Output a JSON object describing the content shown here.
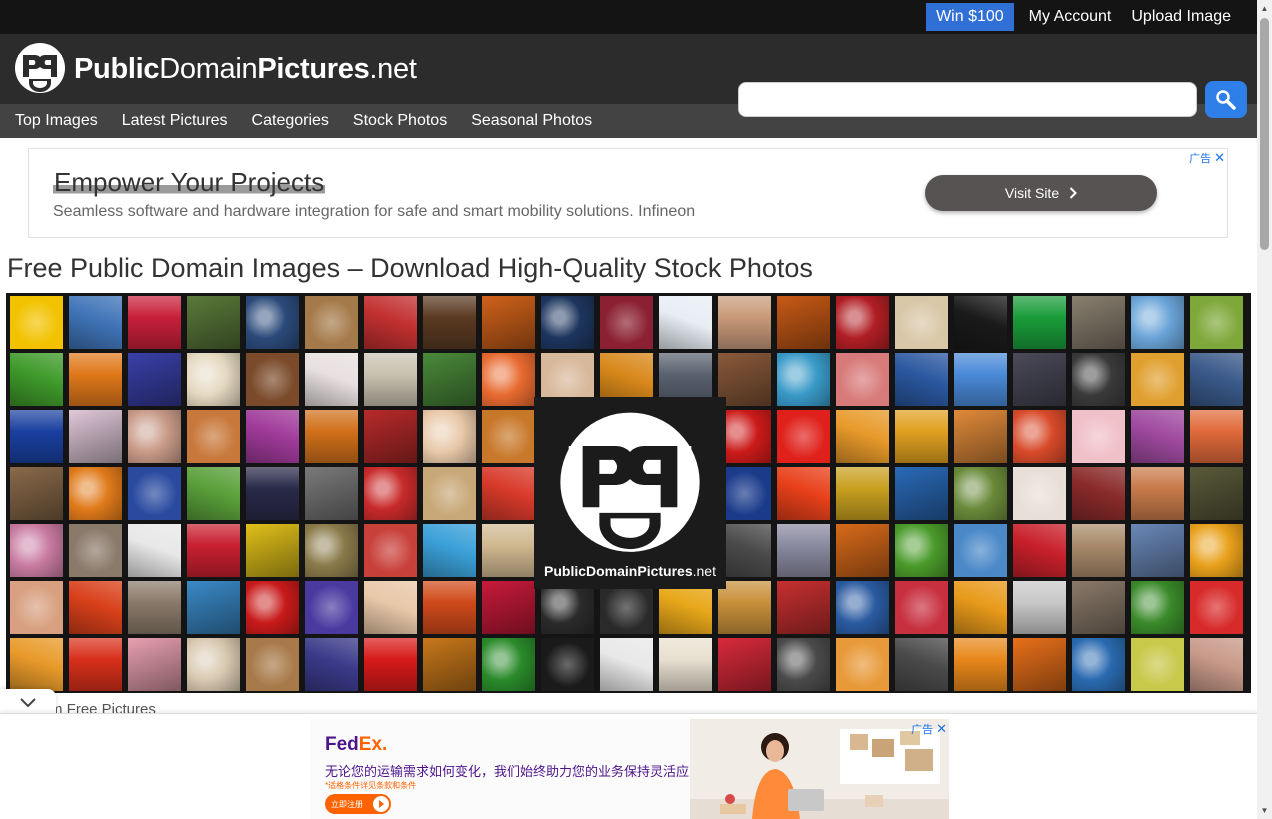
{
  "topbar": {
    "links": [
      {
        "label": "Win $100"
      },
      {
        "label": "My Account"
      },
      {
        "label": "Upload Image"
      }
    ]
  },
  "header": {
    "brand_bold_1": "Public",
    "brand_regular_1": "Domain",
    "brand_bold_2": "Pictures",
    "brand_regular_2": ".net",
    "search_value": "",
    "search_icon": "search-icon",
    "search_button_color": "#2f7fe8"
  },
  "nav": {
    "items": [
      {
        "label": "Top Images"
      },
      {
        "label": "Latest Pictures"
      },
      {
        "label": "Categories"
      },
      {
        "label": "Stock Photos"
      },
      {
        "label": "Seasonal Photos"
      }
    ]
  },
  "ad_top": {
    "headline": "Empower Your Projects",
    "description": "Seamless software and hardware integration for safe and smart mobility solutions. Infineon",
    "cta": "Visit Site",
    "cta_icon": "chevron-right-icon",
    "ad_label": "广告",
    "close_icon": "close-icon"
  },
  "main": {
    "title": "Free Public Domain Images – Download High-Quality Stock Photos",
    "more_label": "m Free Pictures",
    "overlay_brand_bold": "PublicDomainPictures",
    "overlay_brand_regular": ".net"
  },
  "image_grid": {
    "rows": 7,
    "columns": 21,
    "tile_colors": [
      "#f2c200",
      "#3f74b8",
      "#c8203a",
      "#5b7a3a",
      "#2b4a7a",
      "#a57a4a",
      "#c23030",
      "#5a3a22",
      "#d0621a",
      "#1d355e",
      "#8a2032",
      "#e8eef4",
      "#c99a7a",
      "#c85a16",
      "#b01e24",
      "#d9c8a8",
      "#1a1a1a",
      "#1a9c3a",
      "#8a8070",
      "#6aa4d8",
      "#7ea83a",
      "#3f9a2a",
      "#e0781a",
      "#3a40a8",
      "#e4d8c0",
      "#7a4a2a",
      "#e8e0e0",
      "#c8c2b0",
      "#4a8a3a",
      "#e86a30",
      "#d8b89a",
      "#d8881a",
      "#5a6270",
      "#8a5a3a",
      "#3a9ac8",
      "#d87a7a",
      "#2a58a0",
      "#4a8ad8",
      "#4a4a5a",
      "#3a3a3a",
      "#e0a030",
      "#3a5a8a",
      "#1a40a0",
      "#e0c8d8",
      "#c89a88",
      "#c8783a",
      "#a03a9a",
      "#d0701a",
      "#b82a2a",
      "#e8c8a8",
      "#c8782a",
      "#d07a2a",
      "#3a5a2a",
      "#d8a878",
      "#cc1a1a",
      "#e0201a",
      "#e89a2a",
      "#e0a020",
      "#e08a3a",
      "#d84a2a",
      "#f0c0c8",
      "#a04aa0",
      "#e06a3a",
      "#8a6a4a",
      "#e07a1a",
      "#2a4aa0",
      "#5aa03a",
      "#2a2a4a",
      "#7a7a7a",
      "#c82a2a",
      "#c8a878",
      "#d83a2a",
      "#d8c8a8",
      "#a0b8d8",
      "#c88a4a",
      "#1a3a8a",
      "#e8401a",
      "#c8a020",
      "#2a6ab8",
      "#6a8a3a",
      "#e8e0d8",
      "#8a2a2a",
      "#c87a4a",
      "#5a5a3a",
      "#c87aa0",
      "#8a7a6a",
      "#e8e8e8",
      "#c82030",
      "#e0c01a",
      "#8a7a4a",
      "#c8403a",
      "#3aa0d8",
      "#d0b890",
      "#2a2a2a",
      "#d8c8a8",
      "#c83a1a",
      "#4a4a4a",
      "#8a8aa0",
      "#d86a1a",
      "#4a9a2a",
      "#4a88c8",
      "#c8202a",
      "#a88a6a",
      "#6a88b8",
      "#e8a01a",
      "#d8a080",
      "#d8401a",
      "#8a7a6a",
      "#3a8ac8",
      "#c81a1a",
      "#4a3aa0",
      "#e8c8a8",
      "#d04a1a",
      "#c81a3a",
      "#2a2a2a",
      "#2a2a2a",
      "#e8a81a",
      "#c8903a",
      "#c83030",
      "#2a5aa0",
      "#c83040",
      "#e89a1a",
      "#c8c8c8",
      "#8a7a6a",
      "#3a8a2a",
      "#d82a2a",
      "#e89a2a",
      "#d8301a",
      "#e8a0b0",
      "#d8c8b0",
      "#a87a4a",
      "#3a3a8a",
      "#d81a1a",
      "#c8781a",
      "#2a8a2a",
      "#1a1a1a",
      "#e8e8e8",
      "#e8e0d0",
      "#d82a3a",
      "#4a4a4a",
      "#e89a3a",
      "#4a4a4a",
      "#e8881a",
      "#e8701a",
      "#2a6ab0",
      "#c8c84a",
      "#c89a8a"
    ]
  },
  "ad_bottom": {
    "brand_1": "Fed",
    "brand_2": "Ex.",
    "headline": "无论您的运输需求如何变化，我们始终助力您的业务保持灵活应变。",
    "small_print": "*适格条件详见条款和条件",
    "cta": "立即注册",
    "ad_label": "广告",
    "close_icon": "close-icon",
    "collapse_icon": "chevron-down-icon"
  },
  "colors": {
    "topbar_bg": "#141414",
    "header_bg": "#2c2c2c",
    "nav_bg": "#434343",
    "win_badge": "#2f6fd6",
    "fedex_purple": "#4d148c",
    "fedex_orange": "#ff6200"
  }
}
